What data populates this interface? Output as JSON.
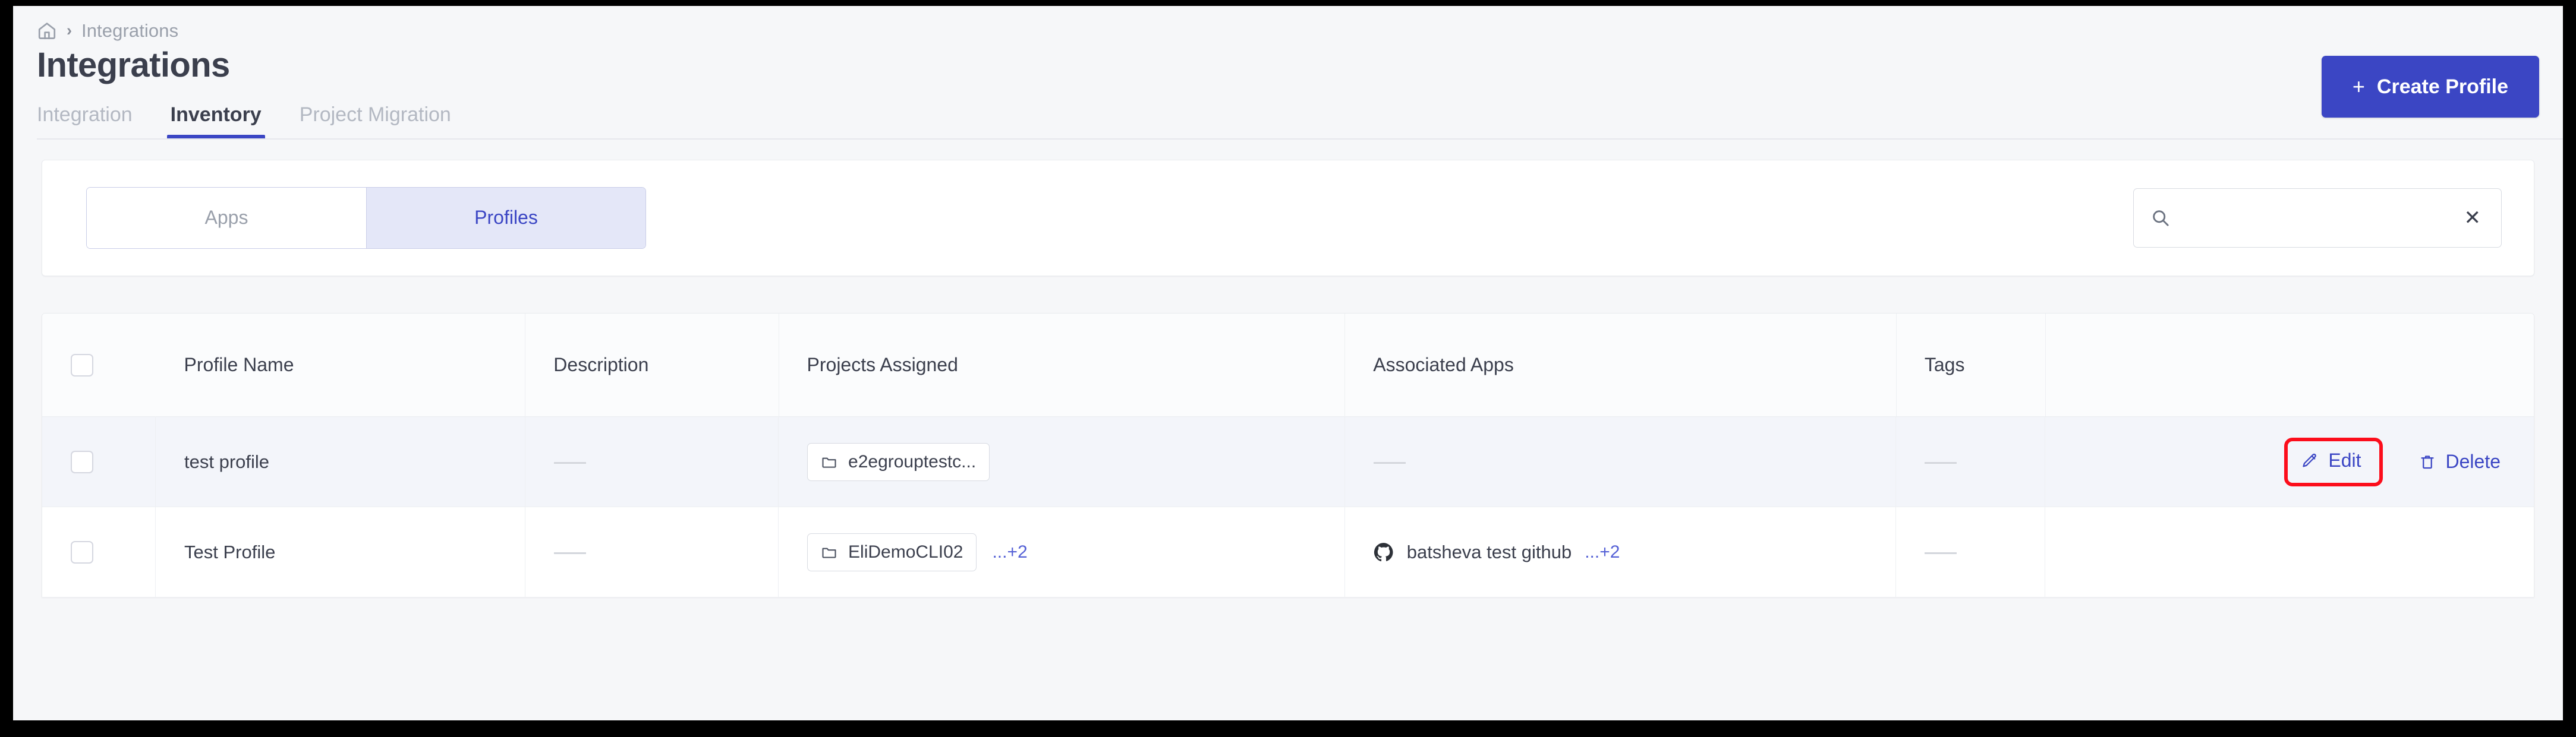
{
  "breadcrumb": {
    "home_icon": "home-icon",
    "separator": "›",
    "current": "Integrations"
  },
  "header": {
    "title": "Integrations",
    "create_button": {
      "plus": "+",
      "label": "Create Profile",
      "color": "#3b46c4"
    }
  },
  "tabs": [
    {
      "label": "Integration",
      "active": false
    },
    {
      "label": "Inventory",
      "active": true
    },
    {
      "label": "Project Migration",
      "active": false
    }
  ],
  "toolbar": {
    "segmented": [
      {
        "label": "Apps",
        "active": false
      },
      {
        "label": "Profiles",
        "active": true
      }
    ],
    "search": {
      "icon": "search-icon",
      "value": "",
      "placeholder": "",
      "clear_label": "✕"
    }
  },
  "table": {
    "columns": [
      "",
      "Profile Name",
      "Description",
      "Projects Assigned",
      "Associated Apps",
      "Tags",
      ""
    ],
    "rows": [
      {
        "selected": false,
        "profile_name": "test profile",
        "description": "—",
        "projects": [
          {
            "icon": "folder-icon",
            "label": "e2egrouptestc..."
          }
        ],
        "projects_more": "",
        "apps": [],
        "apps_more": "",
        "apps_placeholder": "—",
        "tags": "—",
        "actions": {
          "edit_icon": "pencil-icon",
          "edit_label": "Edit",
          "delete_icon": "trash-icon",
          "delete_label": "Delete",
          "edit_highlighted": true
        }
      },
      {
        "selected": false,
        "profile_name": "Test Profile",
        "description": "—",
        "projects": [
          {
            "icon": "folder-icon",
            "label": "EliDemoCLI02"
          }
        ],
        "projects_more": "...+2",
        "apps": [
          {
            "icon": "github-icon",
            "label": "batsheva test github"
          }
        ],
        "apps_more": "...+2",
        "apps_placeholder": "",
        "tags": "—",
        "actions": {
          "edit_icon": "pencil-icon",
          "edit_label": "",
          "delete_icon": "trash-icon",
          "delete_label": "",
          "edit_highlighted": false
        }
      }
    ]
  },
  "colors": {
    "accent": "#3b46c4",
    "annotation": "#fc0d1b",
    "muted_text": "#9aa0ab",
    "heading_text": "#3b3f4d",
    "row_hover": "#f3f5fa"
  }
}
